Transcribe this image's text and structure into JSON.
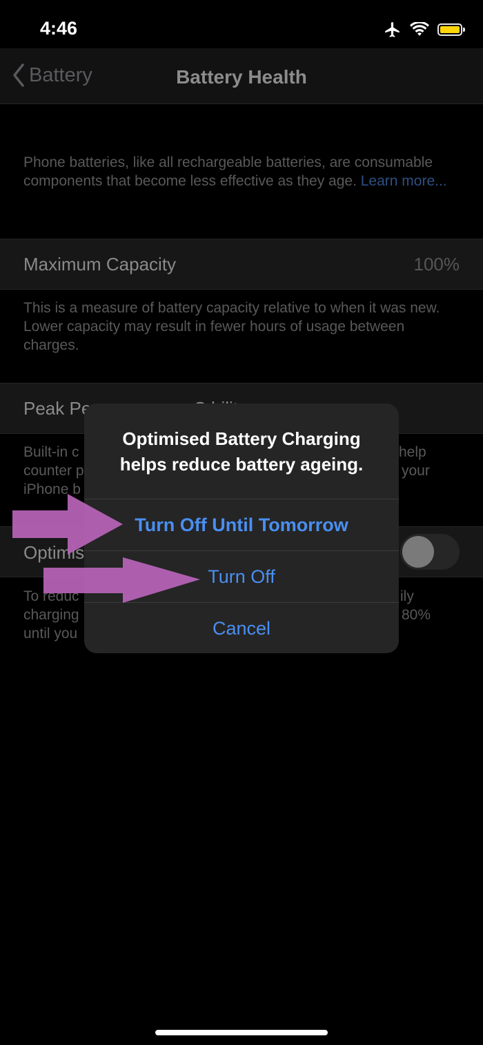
{
  "status_bar": {
    "time": "4:46",
    "icons": [
      "airplane-icon",
      "wifi-icon",
      "battery-icon"
    ],
    "battery_color": "#ffd60a"
  },
  "nav": {
    "back_label": "Battery",
    "title": "Battery Health"
  },
  "intro": {
    "text": "Phone batteries, like all rechargeable batteries, are consumable components that become less effective as they age. ",
    "link": "Learn more..."
  },
  "max_capacity": {
    "label": "Maximum Capacity",
    "value": "100%",
    "description": "This is a measure of battery capacity relative to when it was new. Lower capacity may result in fewer hours of usage between charges."
  },
  "peak_performance": {
    "label_visible": "Peak Pe",
    "label_visible_tail": "C     bilit",
    "description_lines": [
      {
        "left": "Built-in c",
        "right": "help"
      },
      {
        "left": "counter p",
        "right": "your"
      },
      {
        "left": "iPhone b",
        "right": ""
      }
    ]
  },
  "optimised": {
    "label_visible": "Optimis",
    "toggle_on": false,
    "description_lines": [
      {
        "left": "To reduc",
        "right": "ily"
      },
      {
        "left": "charging",
        "right": "80%"
      },
      {
        "left": "until you",
        "right": ""
      }
    ]
  },
  "alert": {
    "title_lines": [
      "Optimised Battery Charging",
      "helps reduce battery ageing."
    ],
    "buttons": [
      {
        "label": "Turn Off Until Tomorrow",
        "bold": true
      },
      {
        "label": "Turn Off",
        "bold": false
      },
      {
        "label": "Cancel",
        "bold": false
      }
    ]
  },
  "annotation": {
    "arrow_color": "#b462b4"
  }
}
